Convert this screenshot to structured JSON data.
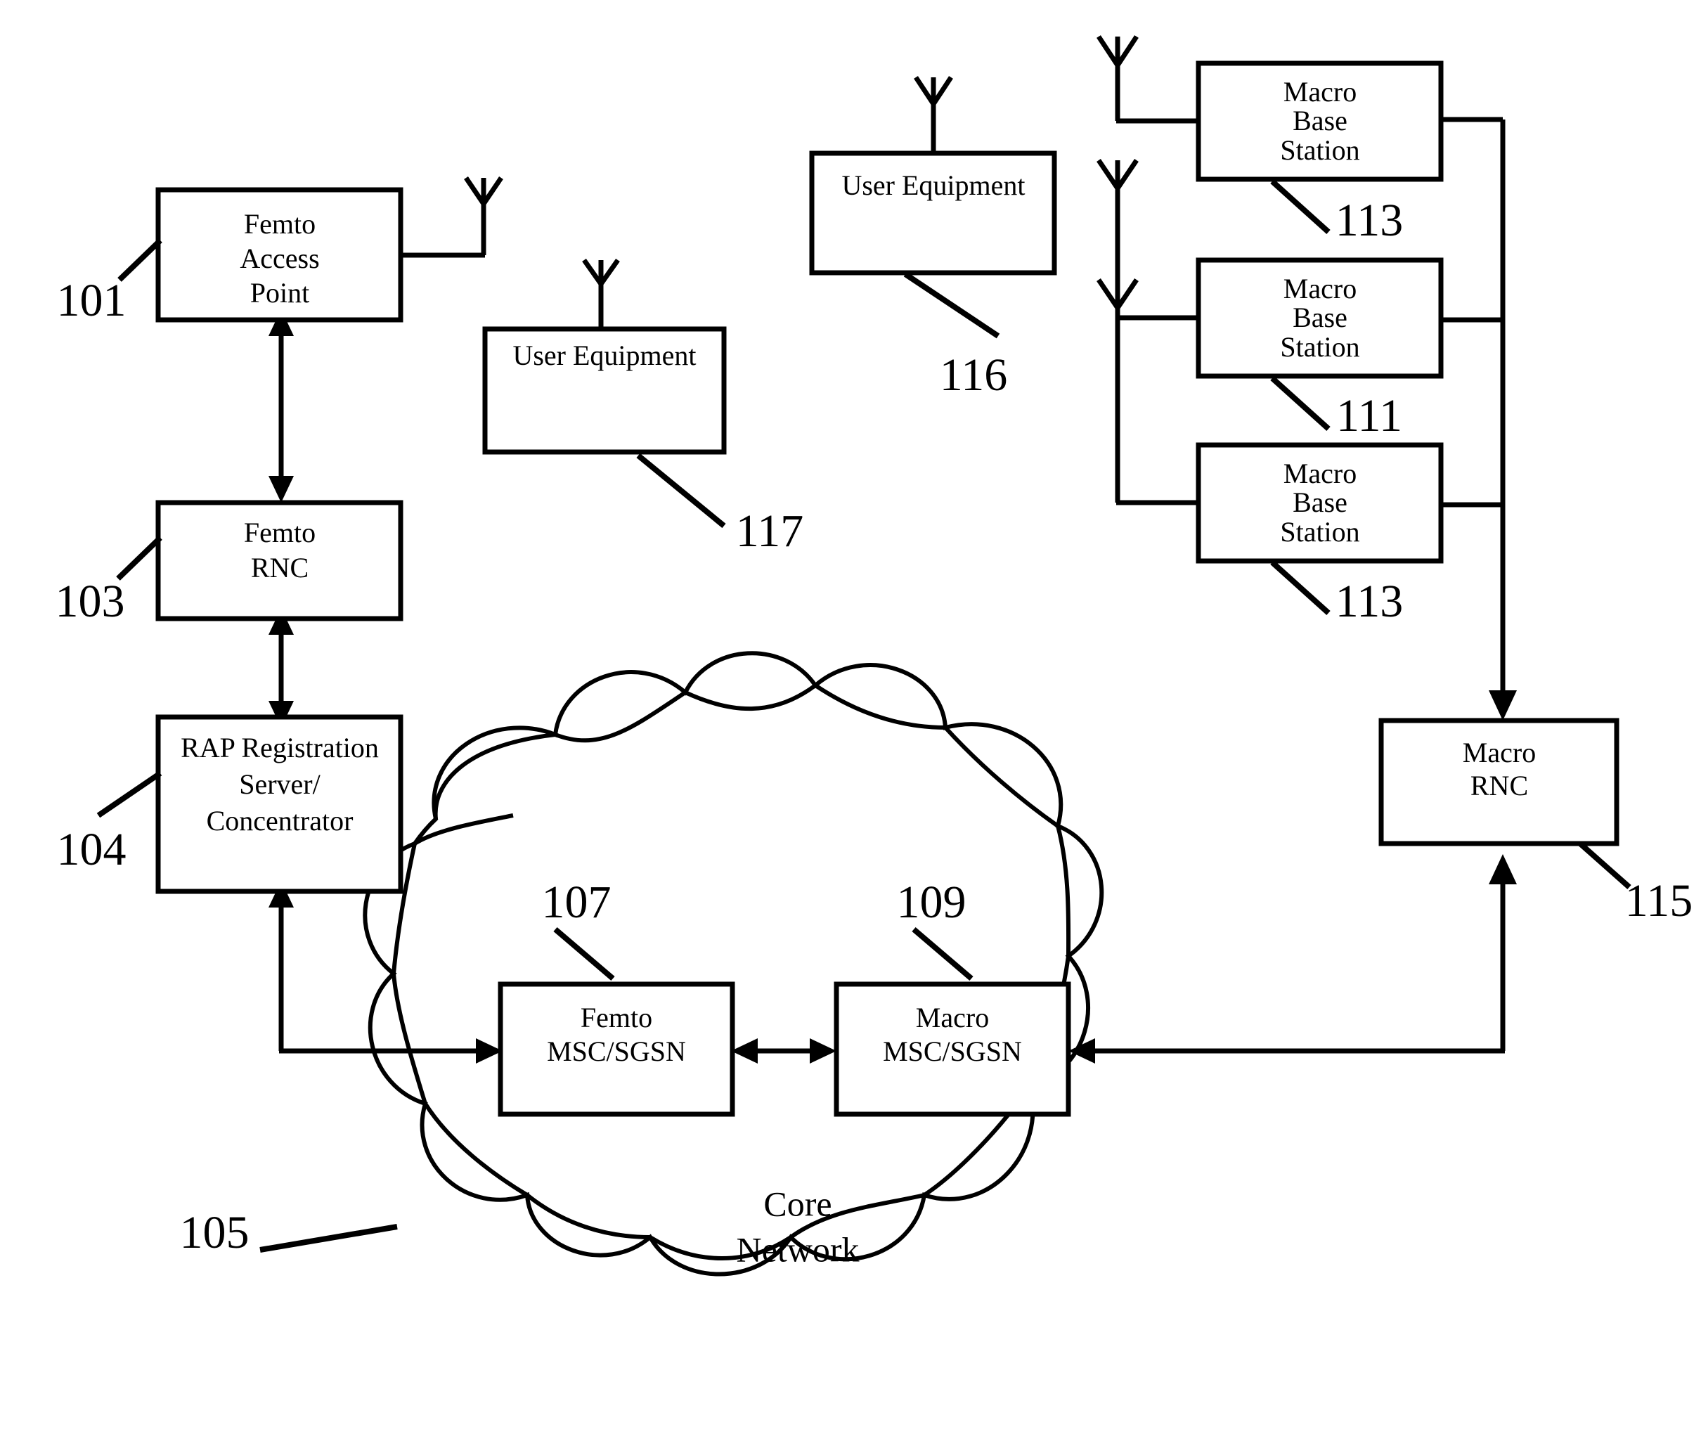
{
  "figure": {
    "type": "network-architecture-diagram",
    "background_color": "#ffffff",
    "line_color": "#000000"
  },
  "nodes": {
    "femto_access_point": {
      "lines": [
        "Femto",
        "Access",
        "Point"
      ],
      "ref": "101"
    },
    "femto_rnc": {
      "lines": [
        "Femto",
        "RNC"
      ],
      "ref": "103"
    },
    "rap_registration_server": {
      "lines": [
        "RAP Registration",
        "Server/",
        "Concentrator"
      ],
      "ref": "104"
    },
    "user_equipment_117": {
      "lines": [
        "User Equipment"
      ],
      "ref": "117"
    },
    "user_equipment_116": {
      "lines": [
        "User Equipment"
      ],
      "ref": "116"
    },
    "macro_base_station_top": {
      "lines": [
        "Macro",
        "Base",
        "Station"
      ],
      "ref": "113"
    },
    "macro_base_station_middle": {
      "lines": [
        "Macro",
        "Base",
        "Station"
      ],
      "ref": "111"
    },
    "macro_base_station_bottom": {
      "lines": [
        "Macro",
        "Base",
        "Station"
      ],
      "ref": "113"
    },
    "macro_rnc": {
      "lines": [
        "Macro",
        "RNC"
      ],
      "ref": "115"
    },
    "femto_msc_sgsn": {
      "lines": [
        "Femto",
        "MSC/SGSN"
      ],
      "ref": "107"
    },
    "macro_msc_sgsn": {
      "lines": [
        "Macro",
        "MSC/SGSN"
      ],
      "ref": "109"
    },
    "core_network": {
      "lines": [
        "Core",
        "Network"
      ],
      "ref": "105"
    }
  }
}
